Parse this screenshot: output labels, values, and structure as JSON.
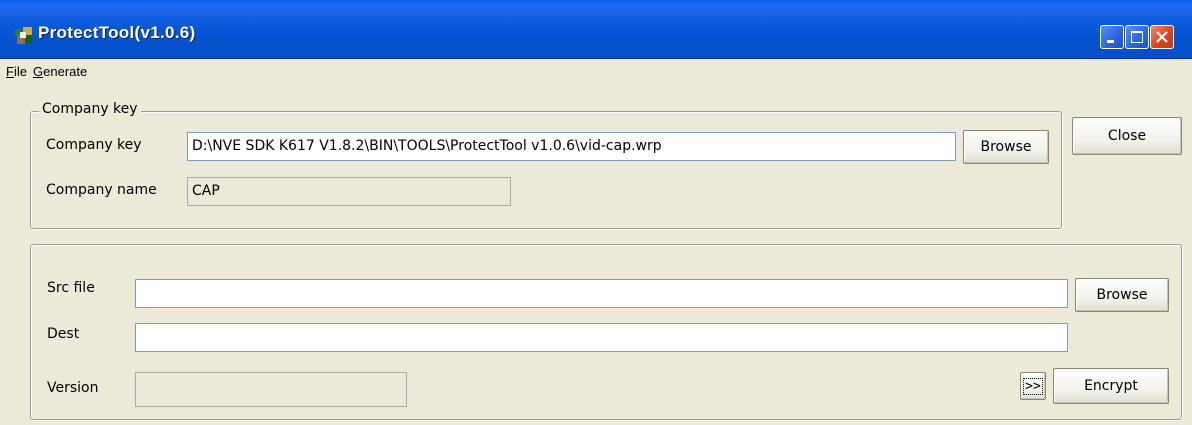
{
  "window": {
    "title": "ProtectTool(v1.0.6)"
  },
  "menu": {
    "file": {
      "accel": "F",
      "rest": "ile"
    },
    "generate": {
      "accel": "G",
      "rest": "enerate"
    }
  },
  "company_group": {
    "legend": "Company key",
    "key_label": "Company key",
    "key_value": "D:\\NVE SDK K617 V1.8.2\\BIN\\TOOLS\\ProtectTool v1.0.6\\vid-cap.wrp",
    "browse_label": "Browse",
    "name_label": "Company name",
    "name_value": "CAP"
  },
  "close_label": "Close",
  "file_group": {
    "src_label": "Src file",
    "src_value": "",
    "browse_label": "Browse",
    "dest_label": "Dest",
    "dest_value": "",
    "version_label": "Version",
    "version_value": "",
    "more_label": ">>",
    "encrypt_label": "Encrypt"
  },
  "colors": {
    "titlebar": "#0a58d8",
    "face": "#ece9d8",
    "close_button": "#d8461e"
  }
}
